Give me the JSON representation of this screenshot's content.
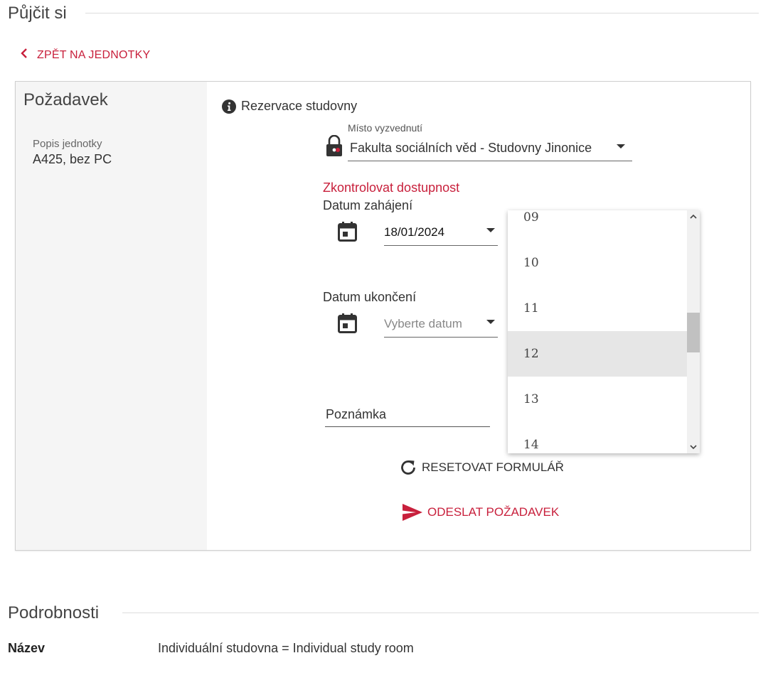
{
  "borrow_section": {
    "title": "Půjčit si"
  },
  "back_link": {
    "label": "ZPĚT NA JEDNOTKY"
  },
  "request_card": {
    "heading": "Požadavek",
    "unit_description_label": "Popis jednotky",
    "unit_description_value": "A425, bez PC",
    "reservation_title": "Rezervace studovny",
    "pickup": {
      "label": "Místo vyzvednutí",
      "value": "Fakulta sociálních věd - Studovny Jinonice"
    },
    "check_availability": "Zkontrolovat dostupnost",
    "start_date": {
      "label": "Datum zahájení",
      "value": "18/01/2024"
    },
    "end_date": {
      "label": "Datum ukončení",
      "placeholder": "Vyberte datum"
    },
    "note": {
      "label": "Poznámka"
    },
    "reset_label": "RESETOVAT FORMULÁŘ",
    "submit_label": "ODESLAT POŽADAVEK"
  },
  "hour_dropdown": {
    "options": [
      "09",
      "10",
      "11",
      "12",
      "13",
      "14"
    ],
    "highlighted": "12"
  },
  "details_section": {
    "title": "Podrobnosti",
    "name_label": "Název",
    "name_value": "Individuální studovna = Individual study room"
  },
  "colors": {
    "accent": "#c8203c",
    "panel": "#f5f5f5",
    "highlight": "#e6e6e6"
  },
  "icons": [
    "chevron-left-icon",
    "info-icon",
    "lock-icon",
    "calendar-icon",
    "refresh-icon",
    "send-icon"
  ]
}
